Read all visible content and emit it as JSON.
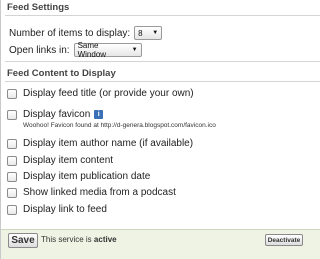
{
  "feed_settings": {
    "heading": "Feed Settings",
    "items_label": "Number of items to display:",
    "items_value": "8",
    "links_label": "Open links in:",
    "links_value": "Same Window"
  },
  "feed_content": {
    "heading": "Feed Content to Display",
    "options": [
      {
        "label": "Display feed title (or provide your own)",
        "checked": false
      },
      {
        "label": "Display favicon",
        "checked": false
      },
      {
        "label": "Display item author name (if available)",
        "checked": false
      },
      {
        "label": "Display item content",
        "checked": false
      },
      {
        "label": "Display item publication date",
        "checked": false
      },
      {
        "label": "Show linked media from a podcast",
        "checked": false
      },
      {
        "label": "Display link to feed",
        "checked": false
      }
    ],
    "favicon_note": "Woohoo! Favicon found at http://d-genera.blogspot.com/favicon.ico",
    "info_icon": "info-icon",
    "info_glyph": "i"
  },
  "footer": {
    "save_label": "Save",
    "status_prefix": "This service is",
    "status_value": "active",
    "deactivate_label": "Deactivate"
  },
  "colors": {
    "footer_bg": "#eef3e4",
    "info_icon": "#3b6fb6"
  }
}
